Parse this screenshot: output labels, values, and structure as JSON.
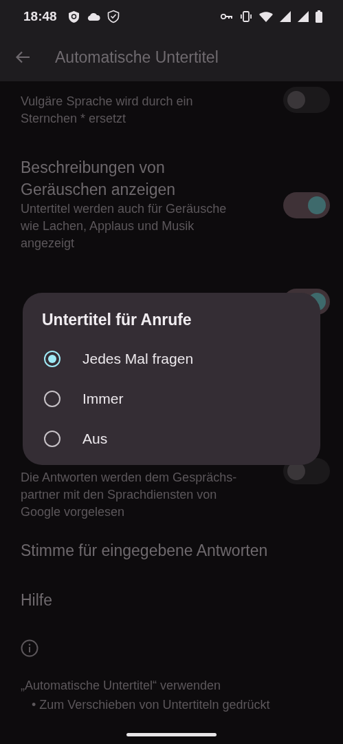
{
  "status_bar": {
    "time": "18:48"
  },
  "app_bar": {
    "title": "Automatische Untertitel"
  },
  "settings": [
    {
      "kind": "toggle",
      "description": "Vulgäre Sprache wird durch ein Sternchen * ersetzt",
      "on": false
    },
    {
      "kind": "toggle",
      "title": "Beschreibungen von Geräuschen anzeigen",
      "description": "Untertitel werden auch für Geräusche wie Lachen, Applaus und Musik angezeigt",
      "on": true
    },
    {
      "kind": "toggle",
      "on": true
    },
    {
      "kind": "toggle",
      "description": "Die Antworten werden dem Gesprächs-partner mit den Sprachdiensten von Google vorgelesen",
      "on": false
    },
    {
      "kind": "link",
      "title": "Stimme für eingegebene Antworten"
    },
    {
      "kind": "link",
      "title": "Hilfe"
    }
  ],
  "info": {
    "heading": "„Automatische Untertitel“ verwenden",
    "bullets": [
      "• Zum Verschieben von Untertiteln gedrückt"
    ]
  },
  "dialog": {
    "title": "Untertitel für Anrufe",
    "options": [
      {
        "label": "Jedes Mal fragen",
        "selected": true
      },
      {
        "label": "Immer",
        "selected": false
      },
      {
        "label": "Aus",
        "selected": false
      }
    ]
  }
}
